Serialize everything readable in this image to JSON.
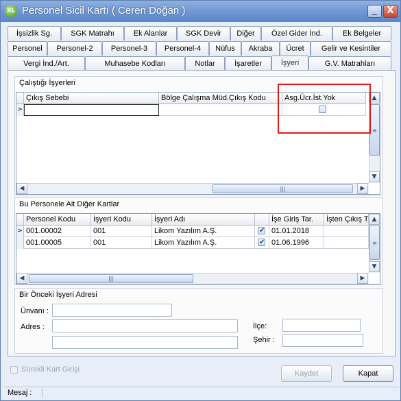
{
  "window": {
    "title": "Personel Sicil Kartı ( Ceren Doğan )",
    "icon_text": "XL",
    "minimize": "_",
    "close": "X"
  },
  "tabs": {
    "row1": [
      "İşsizlik Sg.",
      "SGK Matrahı",
      "Ek Alanlar",
      "SGK Devir",
      "Diğer",
      "Özel Gider İnd.",
      "Ek Belgeler"
    ],
    "row2": [
      "Personel",
      "Personel-2",
      "Personel-3",
      "Personel-4",
      "Nüfus",
      "Akraba",
      "Ücret",
      "Gelir ve Kesintiler"
    ],
    "row3": [
      "Vergi İnd./Art.",
      "Muhasebe Kodları",
      "Notlar",
      "İşaretler",
      "İşyeri",
      "G.V. Matrahları"
    ],
    "active": "İşyeri"
  },
  "worked_workplaces": {
    "title": "Çalıştığı İşyerleri",
    "columns": [
      "Çıkış Sebebi",
      "Bölge Çalışma Müd.Çıkış Kodu",
      "Asg.Ücr.İst.Yok"
    ],
    "row_indicator": ">",
    "row": {
      "cikis_sebebi": "",
      "bolge_kodu": "",
      "asg_ucr_checked": false
    }
  },
  "other_cards": {
    "title": "Bu Personele Ait Diğer Kartlar",
    "columns": [
      "Personel Kodu",
      "İşyeri Kodu",
      "İşyeri Adı",
      "",
      "İşe Giriş Tar.",
      "İşten Çıkış T"
    ],
    "rows": [
      {
        "indicator": ">",
        "personel_kodu": "001.00002",
        "isyeri_kodu": "001",
        "isyeri_adi": "Likom Yazılım A.Ş.",
        "checked": true,
        "ise_giris": "01.01.2018",
        "isten_cikis": ""
      },
      {
        "indicator": "",
        "personel_kodu": "001.00005",
        "isyeri_kodu": "001",
        "isyeri_adi": "Likom Yazılım A.Ş.",
        "checked": true,
        "ise_giris": "01.06.1996",
        "isten_cikis": ""
      }
    ]
  },
  "previous_address": {
    "title": "Bir Önceki İşyeri Adresi",
    "unvan_label": "Ünvanı :",
    "adres_label": "Adres :",
    "ilce_label": "İlçe:",
    "sehir_label": "Şehir :",
    "unvan": "",
    "adres1": "",
    "adres2": "",
    "ilce": "",
    "sehir": ""
  },
  "footer": {
    "surekli_label": "Sürekli Kart Girişi",
    "save_label": "Kaydet",
    "close_label": "Kapat",
    "status_label": "Mesaj :"
  },
  "colors": {
    "highlight": "#e01a1a",
    "titlebar": "#6f97d2"
  }
}
